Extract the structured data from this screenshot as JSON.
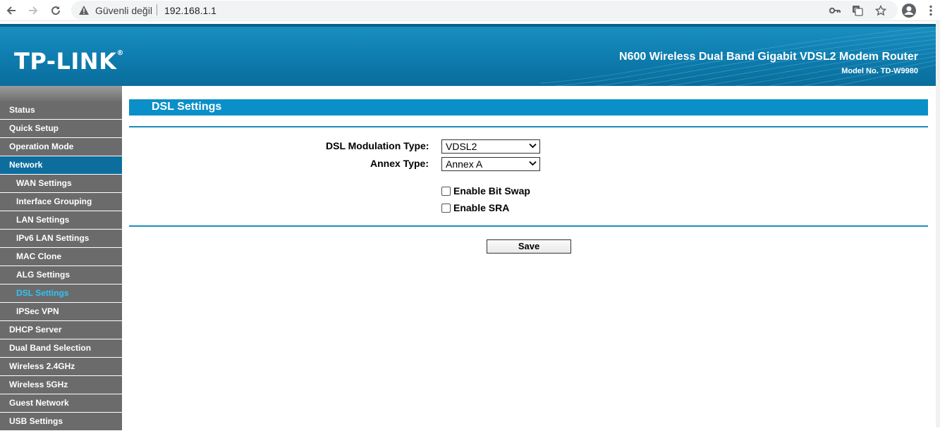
{
  "browser": {
    "security_label": "Güvenli değil",
    "url": "192.168.1.1"
  },
  "banner": {
    "logo": "TP-LINK",
    "logo_mark": "®",
    "product_name": "N600 Wireless Dual Band Gigabit VDSL2 Modem Router",
    "model_no": "Model No. TD-W9980"
  },
  "sidebar": {
    "items": [
      {
        "label": "Status"
      },
      {
        "label": "Quick Setup"
      },
      {
        "label": "Operation Mode"
      },
      {
        "label": "Network"
      },
      {
        "label": "WAN Settings"
      },
      {
        "label": "Interface Grouping"
      },
      {
        "label": "LAN Settings"
      },
      {
        "label": "IPv6 LAN Settings"
      },
      {
        "label": "MAC Clone"
      },
      {
        "label": "ALG Settings"
      },
      {
        "label": "DSL Settings"
      },
      {
        "label": "IPSec VPN"
      },
      {
        "label": "DHCP Server"
      },
      {
        "label": "Dual Band Selection"
      },
      {
        "label": "Wireless 2.4GHz"
      },
      {
        "label": "Wireless 5GHz"
      },
      {
        "label": "Guest Network"
      },
      {
        "label": "USB Settings"
      }
    ]
  },
  "main": {
    "title": "DSL Settings",
    "modulation_label": "DSL Modulation Type:",
    "modulation_value": "VDSL2",
    "annex_label": "Annex Type:",
    "annex_value": "Annex A",
    "bitswap_label": "Enable Bit Swap",
    "sra_label": "Enable SRA",
    "save_label": "Save"
  },
  "colors": {
    "banner_blue": "#0f7fb1",
    "title_bar": "#0a8fc8",
    "active_menu": "#0d6e9e",
    "current_item_text": "#2ec3f5",
    "menu_gray": "#6b6b6b"
  }
}
